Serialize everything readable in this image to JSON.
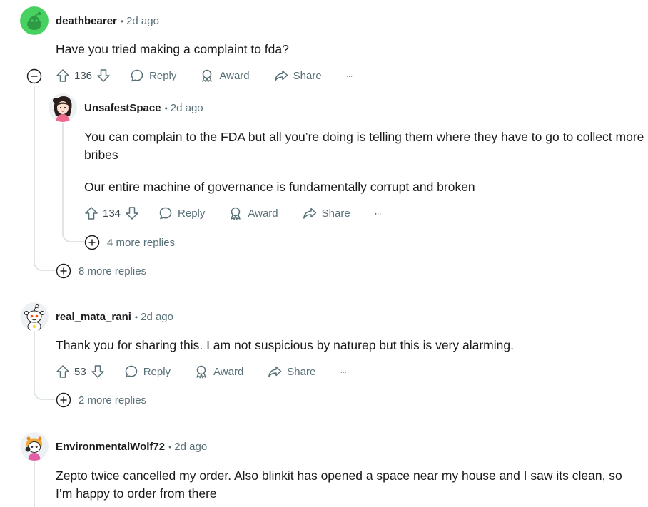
{
  "comments": [
    {
      "author": "deathbearer",
      "separator": "•",
      "time": "2d ago",
      "body": [
        "Have you tried making a complaint to fda?"
      ],
      "score": "136",
      "reply_label": "Reply",
      "award_label": "Award",
      "share_label": "Share",
      "more_label": "···",
      "avatar_icon": "green-snoo-avatar-icon",
      "replies": [
        {
          "author": "UnsafestSpace",
          "separator": "•",
          "time": "2d ago",
          "body": [
            "You can complain to the FDA but all you’re doing is telling them where they have to go to collect more bribes",
            "Our entire machine of governance is fundamentally corrupt and broken"
          ],
          "score": "134",
          "reply_label": "Reply",
          "award_label": "Award",
          "share_label": "Share",
          "more_label": "···",
          "avatar_icon": "girl-avatar-icon",
          "more_replies": "4 more replies"
        }
      ],
      "more_replies": "8 more replies"
    },
    {
      "author": "real_mata_rani",
      "separator": "•",
      "time": "2d ago",
      "body": [
        "Thank you for sharing this. I am not suspicious by naturep but this is very alarming."
      ],
      "score": "53",
      "reply_label": "Reply",
      "award_label": "Award",
      "share_label": "Share",
      "more_label": "···",
      "avatar_icon": "snoo-avatar-icon",
      "more_replies": "2 more replies"
    },
    {
      "author": "EnvironmentalWolf72",
      "separator": "•",
      "time": "2d ago",
      "body": [
        "Zepto twice cancelled my order. Also blinkit has opened a space near my house and I saw its clean, so I’m happy to order from there"
      ],
      "avatar_icon": "costume-avatar-icon"
    }
  ],
  "icons": {
    "upvote": "upvote-icon",
    "downvote": "downvote-icon",
    "reply": "reply-bubble-icon",
    "award": "award-icon",
    "share": "share-arrow-icon",
    "expand": "plus-circle-icon",
    "collapse": "minus-circle-icon"
  },
  "colors": {
    "meta_gray": "#576f76",
    "thread_line": "#dfe4e6",
    "avatar_green": "#46d160"
  }
}
